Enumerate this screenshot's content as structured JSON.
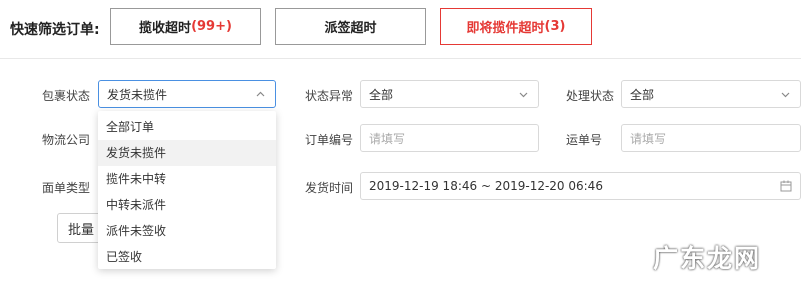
{
  "quick_filter": {
    "label": "快速筛选订单:",
    "buttons": [
      {
        "text": "揽收超时",
        "count": "(99+)"
      },
      {
        "text": "派签超时",
        "count": ""
      },
      {
        "text": "即将揽件超时",
        "count": "(3)"
      }
    ]
  },
  "filters": {
    "package_status": {
      "label": "包裹状态",
      "value": "发货未揽件"
    },
    "status_abnormal": {
      "label": "状态异常",
      "value": "全部"
    },
    "process_status": {
      "label": "处理状态",
      "value": "全部"
    },
    "logistics_company": {
      "label": "物流公司"
    },
    "order_no": {
      "label": "订单编号",
      "placeholder": "请填写"
    },
    "waybill_no": {
      "label": "运单号",
      "placeholder": "请填写"
    },
    "sheet_type": {
      "label": "面单类型"
    },
    "ship_time": {
      "label": "发货时间",
      "value": "2019-12-19 18:46 ~ 2019-12-20 06:46"
    }
  },
  "dropdown": {
    "options": [
      "全部订单",
      "发货未揽件",
      "揽件未中转",
      "中转未派件",
      "派件未签收",
      "已签收"
    ]
  },
  "batch_button": "批量",
  "watermark": "广东龙网",
  "colors": {
    "accent_red": "#e53935",
    "focus_blue": "#4a90e2"
  }
}
